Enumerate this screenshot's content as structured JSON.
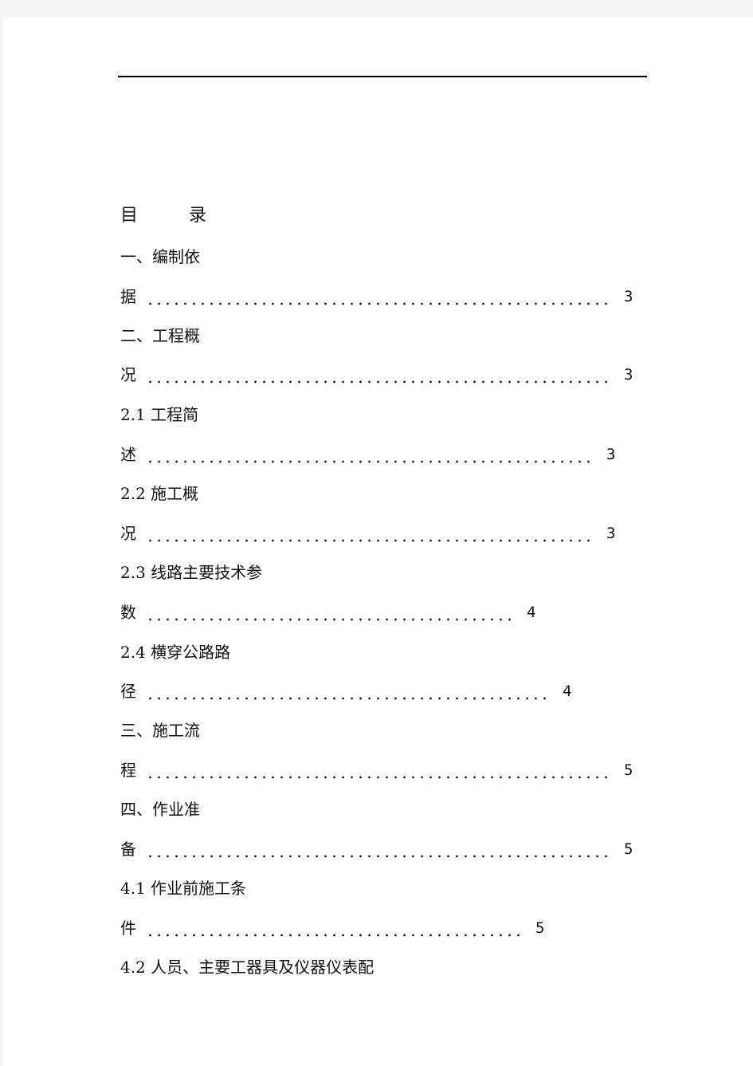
{
  "document": {
    "toc_title_left": "目",
    "toc_title_right": "录",
    "entries": [
      {
        "head": "一、编制依",
        "tail": "据",
        "page": "3"
      },
      {
        "head": "二、工程概",
        "tail": "况",
        "page": "3"
      },
      {
        "head": "2.1 工程简",
        "tail": "述",
        "page": "3"
      },
      {
        "head": "2.2 施工概",
        "tail": "况",
        "page": "3"
      },
      {
        "head": "2.3 线路主要技术参",
        "tail": "数",
        "page": "4"
      },
      {
        "head": "2.4 横穿公路路",
        "tail": "径",
        "page": "4"
      },
      {
        "head": "三、施工流",
        "tail": "程",
        "page": "5"
      },
      {
        "head": "四、作业准",
        "tail": "备",
        "page": "5"
      },
      {
        "head": "4.1 作业前施工条",
        "tail": "件",
        "page": "5"
      },
      {
        "head": "4.2 人员、主要工器具及仪器仪表配",
        "tail": "",
        "page": ""
      }
    ]
  }
}
